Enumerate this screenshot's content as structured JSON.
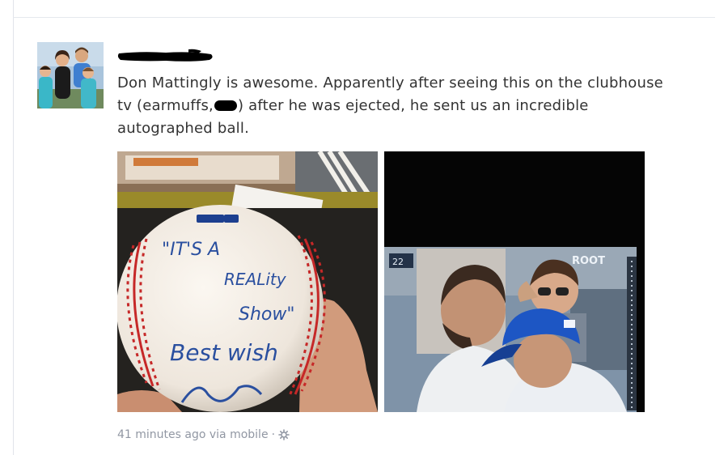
{
  "post": {
    "message": {
      "part1": "Don Mattingly is awesome. Apparently after seeing this on the clubhouse tv (earmuffs,",
      "part2": ") after he was ejected, he sent us an incredible autographed ball."
    },
    "photo1": {
      "ball_lines": [
        "\"IT'S A",
        "REALity",
        "Show\"",
        "Best wish"
      ]
    },
    "photo2": {
      "tv_logo": "ROOT",
      "tv_score": "22"
    },
    "meta": {
      "time": "41 minutes ago",
      "via": "via mobile",
      "separator": "·"
    }
  },
  "colors": {
    "text": "#333333",
    "meta": "#9197a3",
    "divider": "#e5e8ee",
    "ball_ink": "#2a4f9f",
    "ball_stitch": "#c62828",
    "cap_blue": "#1d56c4"
  }
}
